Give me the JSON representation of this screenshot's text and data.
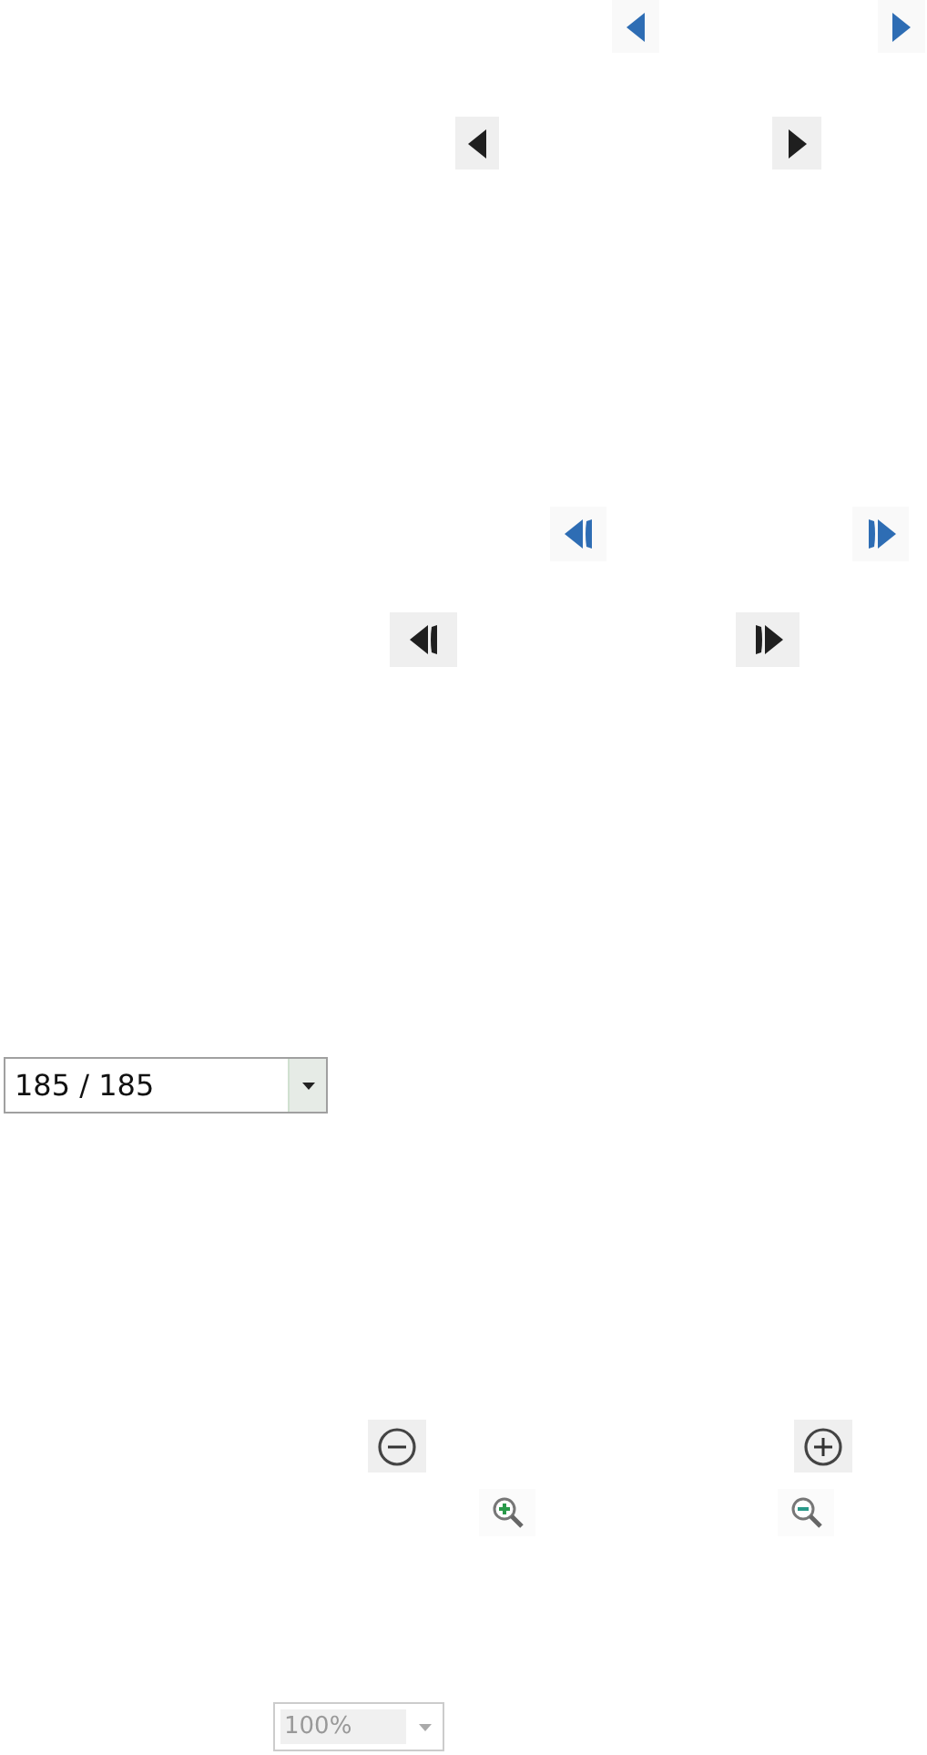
{
  "nav_buttons": [
    {
      "buttons": [
        {
          "kind": "prev",
          "highlighted": true
        },
        {
          "kind": "next",
          "highlighted": true
        }
      ]
    },
    {
      "buttons": [
        {
          "kind": "prev",
          "highlighted": false
        },
        {
          "kind": "next",
          "highlighted": false
        }
      ]
    },
    {
      "buttons": [
        {
          "kind": "first",
          "highlighted": true
        },
        {
          "kind": "last",
          "highlighted": true
        }
      ]
    },
    {
      "buttons": [
        {
          "kind": "first",
          "highlighted": false
        },
        {
          "kind": "last",
          "highlighted": false
        }
      ]
    }
  ],
  "page_select": {
    "value": "185 / 185",
    "disabled": false
  },
  "zoom_buttons": [
    {
      "buttons": [
        {
          "kind": "zoom-out-circle",
          "highlighted": false
        },
        {
          "kind": "zoom-in-circle",
          "highlighted": false
        }
      ]
    },
    {
      "buttons": [
        {
          "kind": "magnify-plus",
          "highlighted": true
        },
        {
          "kind": "magnify-minus",
          "highlighted": true
        }
      ]
    }
  ],
  "zoom_select": {
    "value": "100%",
    "disabled": true
  }
}
